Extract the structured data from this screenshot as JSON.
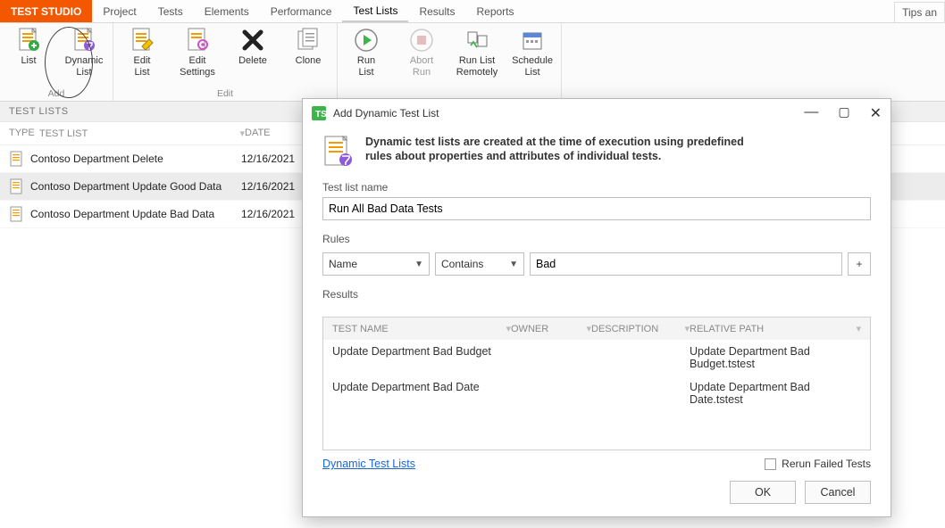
{
  "menubar": {
    "brand": "TEST STUDIO",
    "items": [
      "Project",
      "Tests",
      "Elements",
      "Performance",
      "Test Lists",
      "Results",
      "Reports"
    ],
    "active_index": 4,
    "tips": "Tips an"
  },
  "ribbon": {
    "groups": [
      {
        "label": "Add",
        "buttons": [
          {
            "name": "list-button",
            "label": "List"
          },
          {
            "name": "dynamic-list-button",
            "label": "Dynamic\nList"
          }
        ]
      },
      {
        "label": "Edit",
        "buttons": [
          {
            "name": "edit-list-button",
            "label": "Edit\nList"
          },
          {
            "name": "edit-settings-button",
            "label": "Edit\nSettings"
          },
          {
            "name": "delete-button",
            "label": "Delete"
          },
          {
            "name": "clone-button",
            "label": "Clone"
          }
        ]
      },
      {
        "label": "",
        "buttons": [
          {
            "name": "run-list-button",
            "label": "Run\nList"
          },
          {
            "name": "abort-run-button",
            "label": "Abort\nRun",
            "disabled": true
          },
          {
            "name": "run-list-remotely-button",
            "label": "Run List\nRemotely"
          },
          {
            "name": "schedule-list-button",
            "label": "Schedule\nList"
          }
        ]
      }
    ]
  },
  "test_lists_panel": {
    "title": "TEST LISTS",
    "columns": {
      "type": "TYPE",
      "name": "TEST LIST",
      "date": "DATE"
    },
    "rows": [
      {
        "name": "Contoso Department Delete",
        "date": "12/16/2021"
      },
      {
        "name": "Contoso Department Update Good Data",
        "date": "12/16/2021",
        "selected": true
      },
      {
        "name": "Contoso Department Update Bad Data",
        "date": "12/16/2021"
      }
    ]
  },
  "dialog": {
    "title": "Add Dynamic Test List",
    "intro_line1": "Dynamic test lists are created at the time of execution using predefined",
    "intro_line2": "rules about properties and attributes of individual tests.",
    "name_label": "Test list name",
    "name_value": "Run All Bad Data Tests",
    "rules_label": "Rules",
    "rule_field": "Name",
    "rule_op": "Contains",
    "rule_value": "Bad",
    "add_rule": "+",
    "results_label": "Results",
    "results_columns": {
      "test": "TEST NAME",
      "owner": "OWNER",
      "desc": "DESCRIPTION",
      "path": "RELATIVE PATH"
    },
    "results_rows": [
      {
        "test": "Update Department Bad Budget",
        "owner": "",
        "desc": "",
        "path": "Update Department Bad Budget.tstest"
      },
      {
        "test": "Update Department Bad Date",
        "owner": "",
        "desc": "",
        "path": "Update Department Bad Date.tstest"
      }
    ],
    "link": "Dynamic Test Lists",
    "rerun_label": "Rerun Failed Tests",
    "ok": "OK",
    "cancel": "Cancel"
  }
}
